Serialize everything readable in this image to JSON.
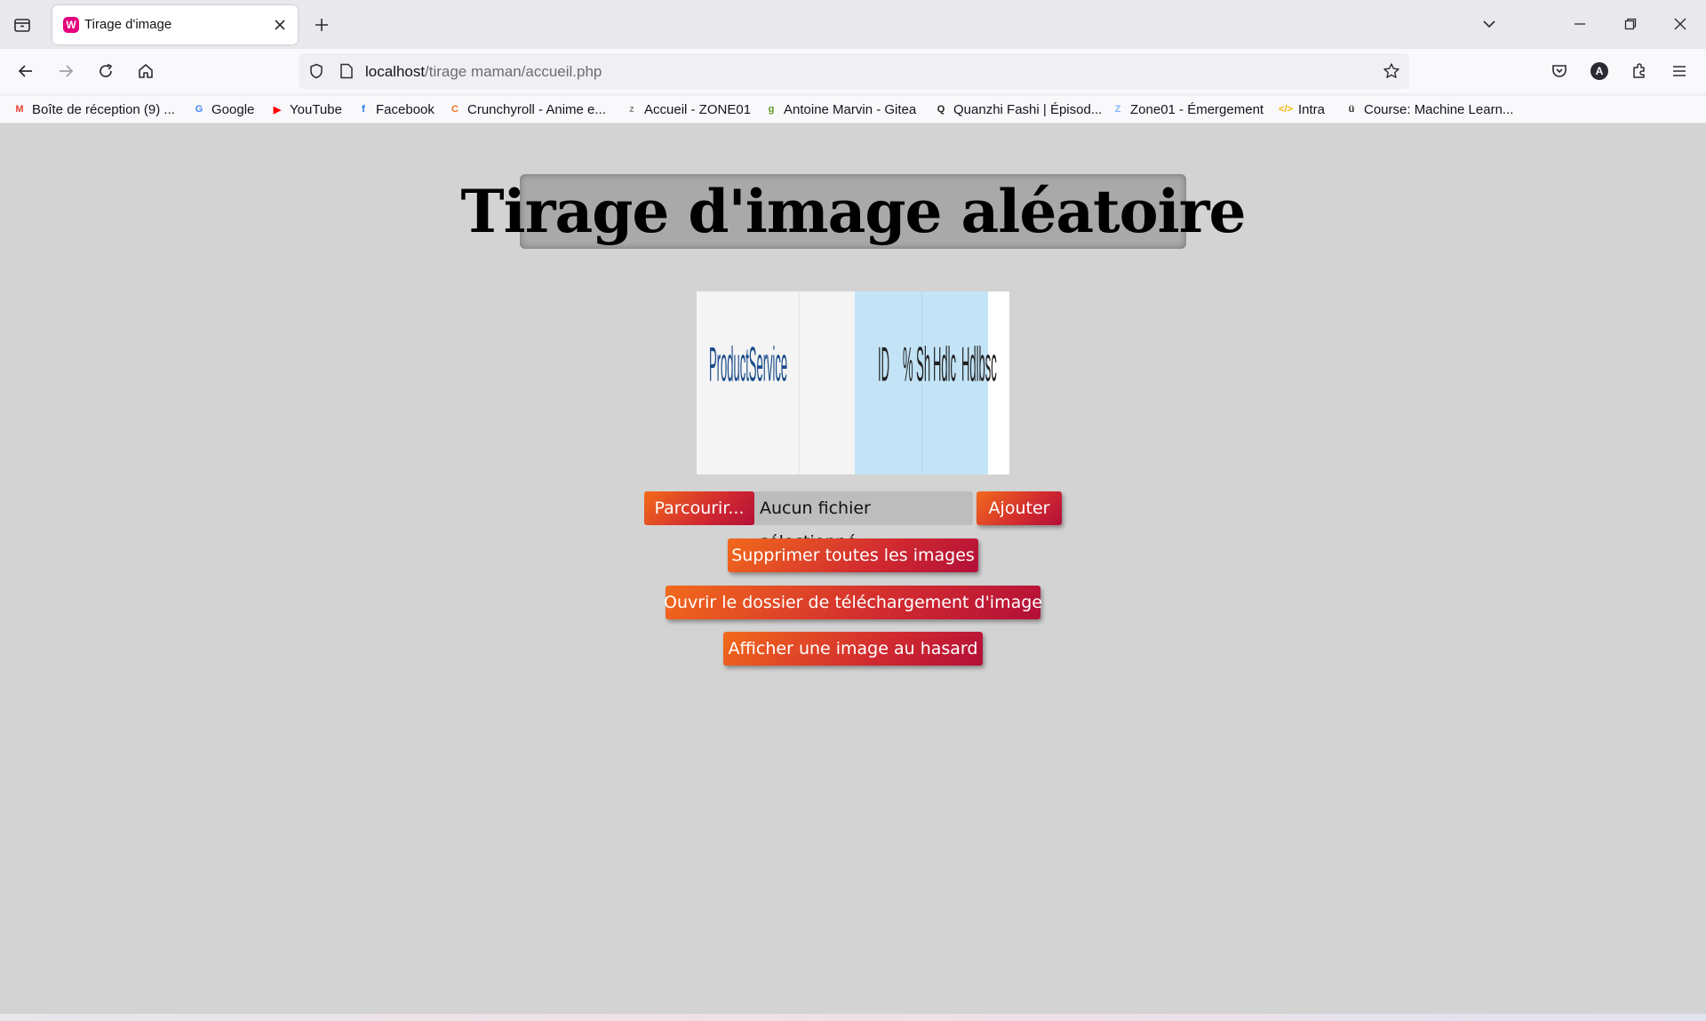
{
  "browser": {
    "tab_title": "Tirage d'image",
    "favicon_letter": "W",
    "url_host": "localhost",
    "url_path": "/tirage maman/accueil.php",
    "account_initial": "A"
  },
  "bookmarks": [
    {
      "label": "Boîte de réception (9) ...",
      "icon": "gmail-icon",
      "color": "#ea4335",
      "glyph": "M"
    },
    {
      "label": "Google",
      "icon": "google-icon",
      "color": "#4285f4",
      "glyph": "G"
    },
    {
      "label": "YouTube",
      "icon": "youtube-icon",
      "color": "#ff0000",
      "glyph": "▶"
    },
    {
      "label": "Facebook",
      "icon": "facebook-icon",
      "color": "#1877f2",
      "glyph": "f"
    },
    {
      "label": "Crunchyroll - Anime e...",
      "icon": "crunchyroll-icon",
      "color": "#f47521",
      "glyph": "C"
    },
    {
      "label": "Accueil - ZONE01",
      "icon": "zone01-icon",
      "color": "#888888",
      "glyph": "z"
    },
    {
      "label": "Antoine Marvin - Gitea",
      "icon": "gitea-icon",
      "color": "#609926",
      "glyph": "g"
    },
    {
      "label": "Quanzhi Fashi | Épisod...",
      "icon": "quanzhi-icon",
      "color": "#222222",
      "glyph": "Q"
    },
    {
      "label": "Zone01 - Émergement",
      "icon": "zone01-emergement-icon",
      "color": "#8ab4f8",
      "glyph": "Z"
    },
    {
      "label": "Intra",
      "icon": "code-icon",
      "color": "#f4b400",
      "glyph": "</>"
    },
    {
      "label": "Course: Machine Learn...",
      "icon": "course-icon",
      "color": "#333333",
      "glyph": "ü"
    }
  ],
  "page": {
    "title": "Tirage d'image aléatoire",
    "image_text": [
      "ProductService",
      "ID",
      "% Sh",
      "Hdlc",
      "Hdlbsc"
    ],
    "browse_label": "Parcourir...",
    "file_status": "Aucun fichier sélectionné.",
    "add_label": "Ajouter",
    "delete_all_label": "Supprimer toutes les images",
    "open_folder_label": "Ouvrir le dossier de téléchargement d'image",
    "random_label": "Afficher une image au hasard"
  },
  "colors": {
    "page_bg": "#d3d3d3",
    "title_box": "#a9a9a9",
    "button_gradient_start": "#f26a1b",
    "button_gradient_end": "#b30f38"
  }
}
